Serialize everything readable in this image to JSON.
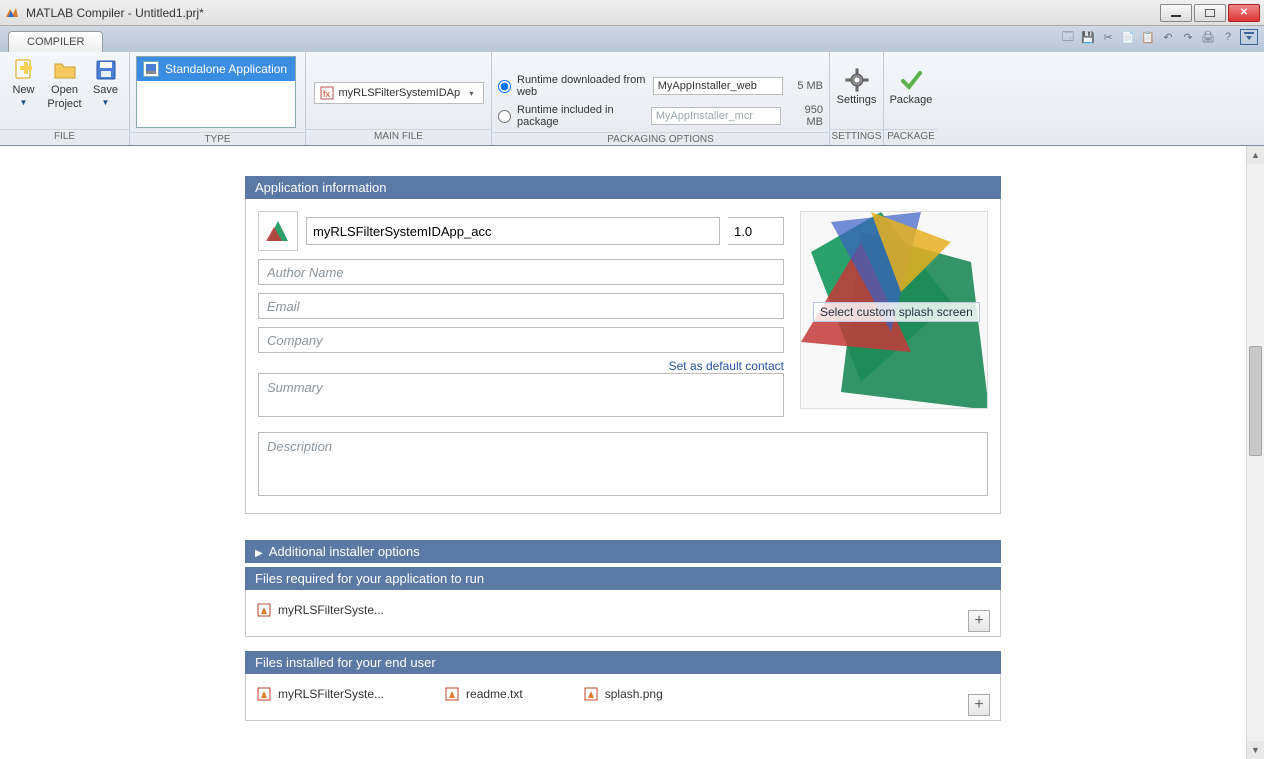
{
  "window": {
    "title": "MATLAB Compiler - Untitled1.prj*"
  },
  "tab": {
    "compiler": "COMPILER"
  },
  "ribbon": {
    "file": {
      "new": "New",
      "open_line1": "Open",
      "open_line2": "Project",
      "save": "Save",
      "cap": "FILE"
    },
    "type": {
      "item": "Standalone Application",
      "cap": "TYPE"
    },
    "mainfile": {
      "name": "myRLSFilterSystemIDAp",
      "cap": "MAIN FILE"
    },
    "pkg": {
      "opt_web": "Runtime downloaded from web",
      "name_web": "MyAppInstaller_web",
      "size_web": "5 MB",
      "opt_mcr": "Runtime included in package",
      "name_mcr": "MyAppInstaller_mcr",
      "size_mcr": "950 MB",
      "cap": "PACKAGING OPTIONS"
    },
    "settings": {
      "label": "Settings",
      "cap": "SETTINGS"
    },
    "package": {
      "label": "Package",
      "cap": "PACKAGE"
    }
  },
  "appinfo": {
    "header": "Application information",
    "name": "myRLSFilterSystemIDApp_acc",
    "version": "1.0",
    "author_ph": "Author Name",
    "email_ph": "Email",
    "company_ph": "Company",
    "default_contact": "Set as default contact",
    "summary_ph": "Summary",
    "description_ph": "Description",
    "splash_hint": "Select custom splash screen"
  },
  "sections": {
    "additional": "Additional installer options",
    "required": "Files required for your application to run",
    "installed": "Files installed for your end user"
  },
  "files": {
    "required": [
      "myRLSFilterSyste..."
    ],
    "installed": [
      "myRLSFilterSyste...",
      "readme.txt",
      "splash.png"
    ]
  }
}
